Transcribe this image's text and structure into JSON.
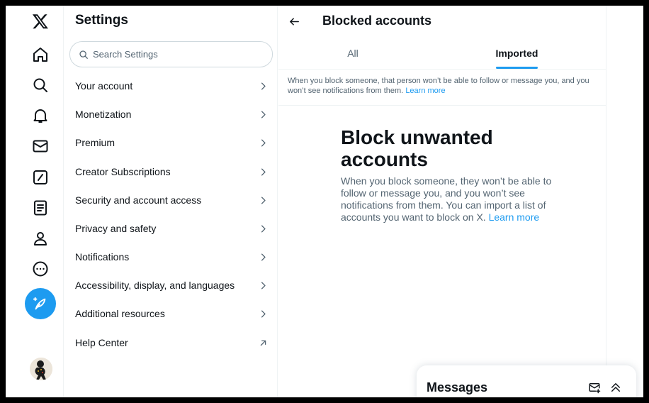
{
  "nav": {
    "items": [
      {
        "icon": "x-logo-icon"
      },
      {
        "icon": "home-icon"
      },
      {
        "icon": "search-icon"
      },
      {
        "icon": "notifications-bell-icon"
      },
      {
        "icon": "messages-envelope-icon"
      },
      {
        "icon": "grok-icon"
      },
      {
        "icon": "lists-icon"
      },
      {
        "icon": "profile-icon"
      },
      {
        "icon": "more-icon"
      }
    ],
    "compose_icon": "post-feather-icon"
  },
  "settings": {
    "title": "Settings",
    "search_placeholder": "Search Settings",
    "items": [
      {
        "label": "Your account",
        "icon": "chevron-right-icon"
      },
      {
        "label": "Monetization",
        "icon": "chevron-right-icon"
      },
      {
        "label": "Premium",
        "icon": "chevron-right-icon"
      },
      {
        "label": "Creator Subscriptions",
        "icon": "chevron-right-icon"
      },
      {
        "label": "Security and account access",
        "icon": "chevron-right-icon"
      },
      {
        "label": "Privacy and safety",
        "icon": "chevron-right-icon"
      },
      {
        "label": "Notifications",
        "icon": "chevron-right-icon"
      },
      {
        "label": "Accessibility, display, and languages",
        "icon": "chevron-right-icon"
      },
      {
        "label": "Additional resources",
        "icon": "chevron-right-icon"
      },
      {
        "label": "Help Center",
        "icon": "external-arrow-icon"
      }
    ]
  },
  "main": {
    "title": "Blocked accounts",
    "tabs": [
      {
        "label": "All",
        "active": false
      },
      {
        "label": "Imported",
        "active": true
      }
    ],
    "info_text": "When you block someone, that person won’t be able to follow or message you, and you won’t see notifications from them.",
    "info_link": "Learn more",
    "empty_title": "Block unwanted accounts",
    "empty_text": "When you block someone, they won’t be able to follow or message you, and you won’t see notifications from them. You can import a list of accounts you want to block on X.",
    "empty_link": "Learn more"
  },
  "messages": {
    "title": "Messages",
    "new_message_icon": "new-message-icon",
    "collapse_icon": "double-chevron-up-icon"
  },
  "colors": {
    "accent": "#1d9bf0",
    "text_primary": "#0f1419",
    "text_secondary": "#536471",
    "border": "#eff3f4"
  }
}
